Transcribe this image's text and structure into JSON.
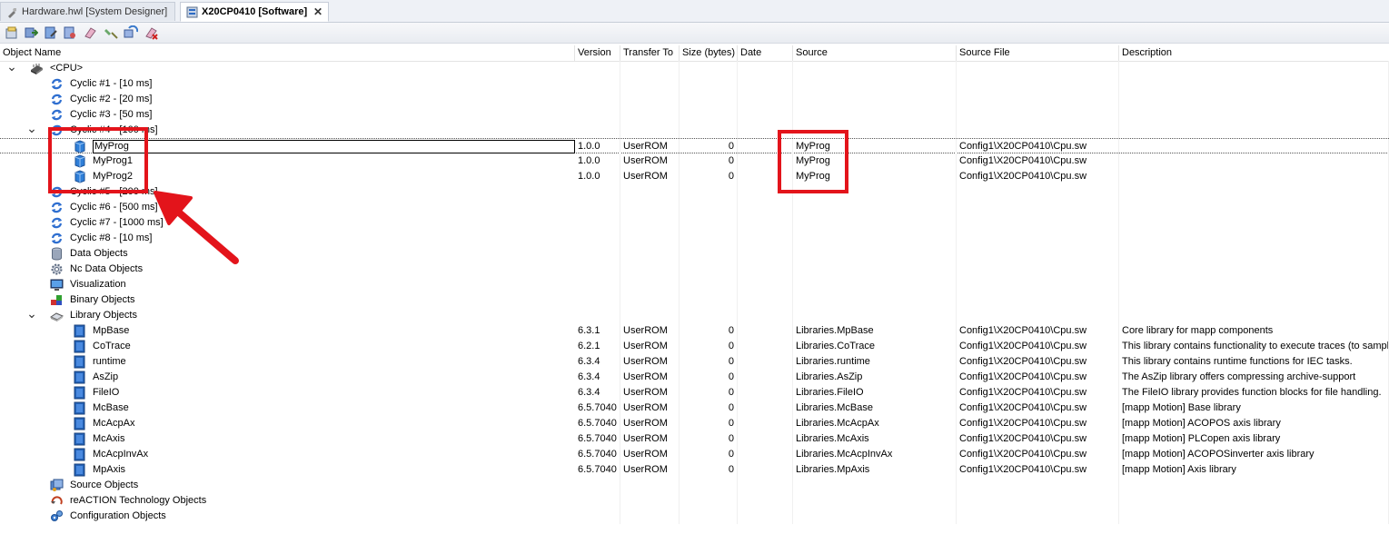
{
  "tabs": [
    {
      "label": "Hardware.hwl [System Designer]",
      "active": false,
      "icon": "hardware-icon"
    },
    {
      "label": "X20CP0410 [Software]",
      "active": true,
      "icon": "software-icon",
      "close": "✕"
    }
  ],
  "toolbar": {
    "buttons": [
      "add-object-icon",
      "transfer-icon",
      "edit-icon",
      "build-icon",
      "clear-icon",
      "move-icon",
      "sync-icon",
      "delete-icon"
    ]
  },
  "columns": {
    "name": "Object Name",
    "version": "Version",
    "transfer": "Transfer To",
    "size": "Size (bytes)",
    "date": "Date",
    "source": "Source",
    "source_file": "Source File",
    "description": "Description"
  },
  "rows": [
    {
      "name": "<CPU>",
      "level": 0,
      "expander": "expanded",
      "icon": "cpu-icon"
    },
    {
      "name": "Cyclic #1 - [10 ms]",
      "level": 1,
      "icon": "cyclic-icon"
    },
    {
      "name": "Cyclic #2 - [20 ms]",
      "level": 1,
      "icon": "cyclic-icon"
    },
    {
      "name": "Cyclic #3 - [50 ms]",
      "level": 1,
      "icon": "cyclic-icon"
    },
    {
      "name": "Cyclic #4 - [100 ms]",
      "level": 1,
      "expander": "expanded",
      "icon": "cyclic-icon"
    },
    {
      "name": "MyProg",
      "level": 2,
      "icon": "program-icon",
      "version": "1.0.0",
      "transfer": "UserROM",
      "size": "0",
      "source": "MyProg",
      "file": "Config1\\X20CP0410\\Cpu.sw",
      "selected": true
    },
    {
      "name": "MyProg1",
      "level": 2,
      "icon": "program-icon",
      "version": "1.0.0",
      "transfer": "UserROM",
      "size": "0",
      "source": "MyProg",
      "file": "Config1\\X20CP0410\\Cpu.sw"
    },
    {
      "name": "MyProg2",
      "level": 2,
      "icon": "program-icon",
      "version": "1.0.0",
      "transfer": "UserROM",
      "size": "0",
      "source": "MyProg",
      "file": "Config1\\X20CP0410\\Cpu.sw"
    },
    {
      "name": "Cyclic #5 - [200 ms]",
      "level": 1,
      "icon": "cyclic-icon"
    },
    {
      "name": "Cyclic #6 - [500 ms]",
      "level": 1,
      "icon": "cyclic-icon"
    },
    {
      "name": "Cyclic #7 - [1000 ms]",
      "level": 1,
      "icon": "cyclic-icon"
    },
    {
      "name": "Cyclic #8 - [10 ms]",
      "level": 1,
      "icon": "cyclic-icon"
    },
    {
      "name": "Data Objects",
      "level": 1,
      "icon": "data-objects-icon"
    },
    {
      "name": "Nc Data Objects",
      "level": 1,
      "icon": "nc-data-objects-icon"
    },
    {
      "name": "Visualization",
      "level": 1,
      "icon": "visualization-icon"
    },
    {
      "name": "Binary Objects",
      "level": 1,
      "icon": "binary-objects-icon"
    },
    {
      "name": "Library Objects",
      "level": 1,
      "expander": "expanded",
      "icon": "library-objects-icon"
    },
    {
      "name": "MpBase",
      "level": 2,
      "icon": "library-icon",
      "version": "6.3.1",
      "transfer": "UserROM",
      "size": "0",
      "source": "Libraries.MpBase",
      "file": "Config1\\X20CP0410\\Cpu.sw",
      "desc": "Core library for mapp components"
    },
    {
      "name": "CoTrace",
      "level": 2,
      "icon": "library-icon",
      "version": "6.2.1",
      "transfer": "UserROM",
      "size": "0",
      "source": "Libraries.CoTrace",
      "file": "Config1\\X20CP0410\\Cpu.sw",
      "desc": "This library contains functionality to execute traces (to sample"
    },
    {
      "name": "runtime",
      "level": 2,
      "icon": "library-icon",
      "version": "6.3.4",
      "transfer": "UserROM",
      "size": "0",
      "source": "Libraries.runtime",
      "file": "Config1\\X20CP0410\\Cpu.sw",
      "desc": "This library contains runtime functions for IEC tasks."
    },
    {
      "name": "AsZip",
      "level": 2,
      "icon": "library-icon",
      "version": "6.3.4",
      "transfer": "UserROM",
      "size": "0",
      "source": "Libraries.AsZip",
      "file": "Config1\\X20CP0410\\Cpu.sw",
      "desc": "The AsZip library offers compressing archive-support"
    },
    {
      "name": "FileIO",
      "level": 2,
      "icon": "library-icon",
      "version": "6.3.4",
      "transfer": "UserROM",
      "size": "0",
      "source": "Libraries.FileIO",
      "file": "Config1\\X20CP0410\\Cpu.sw",
      "desc": "The FileIO library provides function blocks for file handling."
    },
    {
      "name": "McBase",
      "level": 2,
      "icon": "library-icon",
      "version": "6.5.7040",
      "transfer": "UserROM",
      "size": "0",
      "source": "Libraries.McBase",
      "file": "Config1\\X20CP0410\\Cpu.sw",
      "desc": "[mapp Motion] Base library"
    },
    {
      "name": "McAcpAx",
      "level": 2,
      "icon": "library-icon",
      "version": "6.5.7040",
      "transfer": "UserROM",
      "size": "0",
      "source": "Libraries.McAcpAx",
      "file": "Config1\\X20CP0410\\Cpu.sw",
      "desc": "[mapp Motion] ACOPOS axis library"
    },
    {
      "name": "McAxis",
      "level": 2,
      "icon": "library-icon",
      "version": "6.5.7040",
      "transfer": "UserROM",
      "size": "0",
      "source": "Libraries.McAxis",
      "file": "Config1\\X20CP0410\\Cpu.sw",
      "desc": "[mapp Motion] PLCopen axis library"
    },
    {
      "name": "McAcpInvAx",
      "level": 2,
      "icon": "library-icon",
      "version": "6.5.7040",
      "transfer": "UserROM",
      "size": "0",
      "source": "Libraries.McAcpInvAx",
      "file": "Config1\\X20CP0410\\Cpu.sw",
      "desc": "[mapp Motion] ACOPOSinverter axis library"
    },
    {
      "name": "MpAxis",
      "level": 2,
      "icon": "library-icon",
      "version": "6.5.7040",
      "transfer": "UserROM",
      "size": "0",
      "source": "Libraries.MpAxis",
      "file": "Config1\\X20CP0410\\Cpu.sw",
      "desc": "[mapp Motion] Axis library"
    },
    {
      "name": "Source Objects",
      "level": 1,
      "icon": "source-objects-icon"
    },
    {
      "name": "reACTION Technology Objects",
      "level": 1,
      "icon": "reaction-icon"
    },
    {
      "name": "Configuration Objects",
      "level": 1,
      "icon": "configuration-objects-icon"
    }
  ],
  "annotation_color": "#e3141b",
  "annotations": [
    "name-highlight-box",
    "source-highlight-box",
    "pointer-arrow"
  ]
}
